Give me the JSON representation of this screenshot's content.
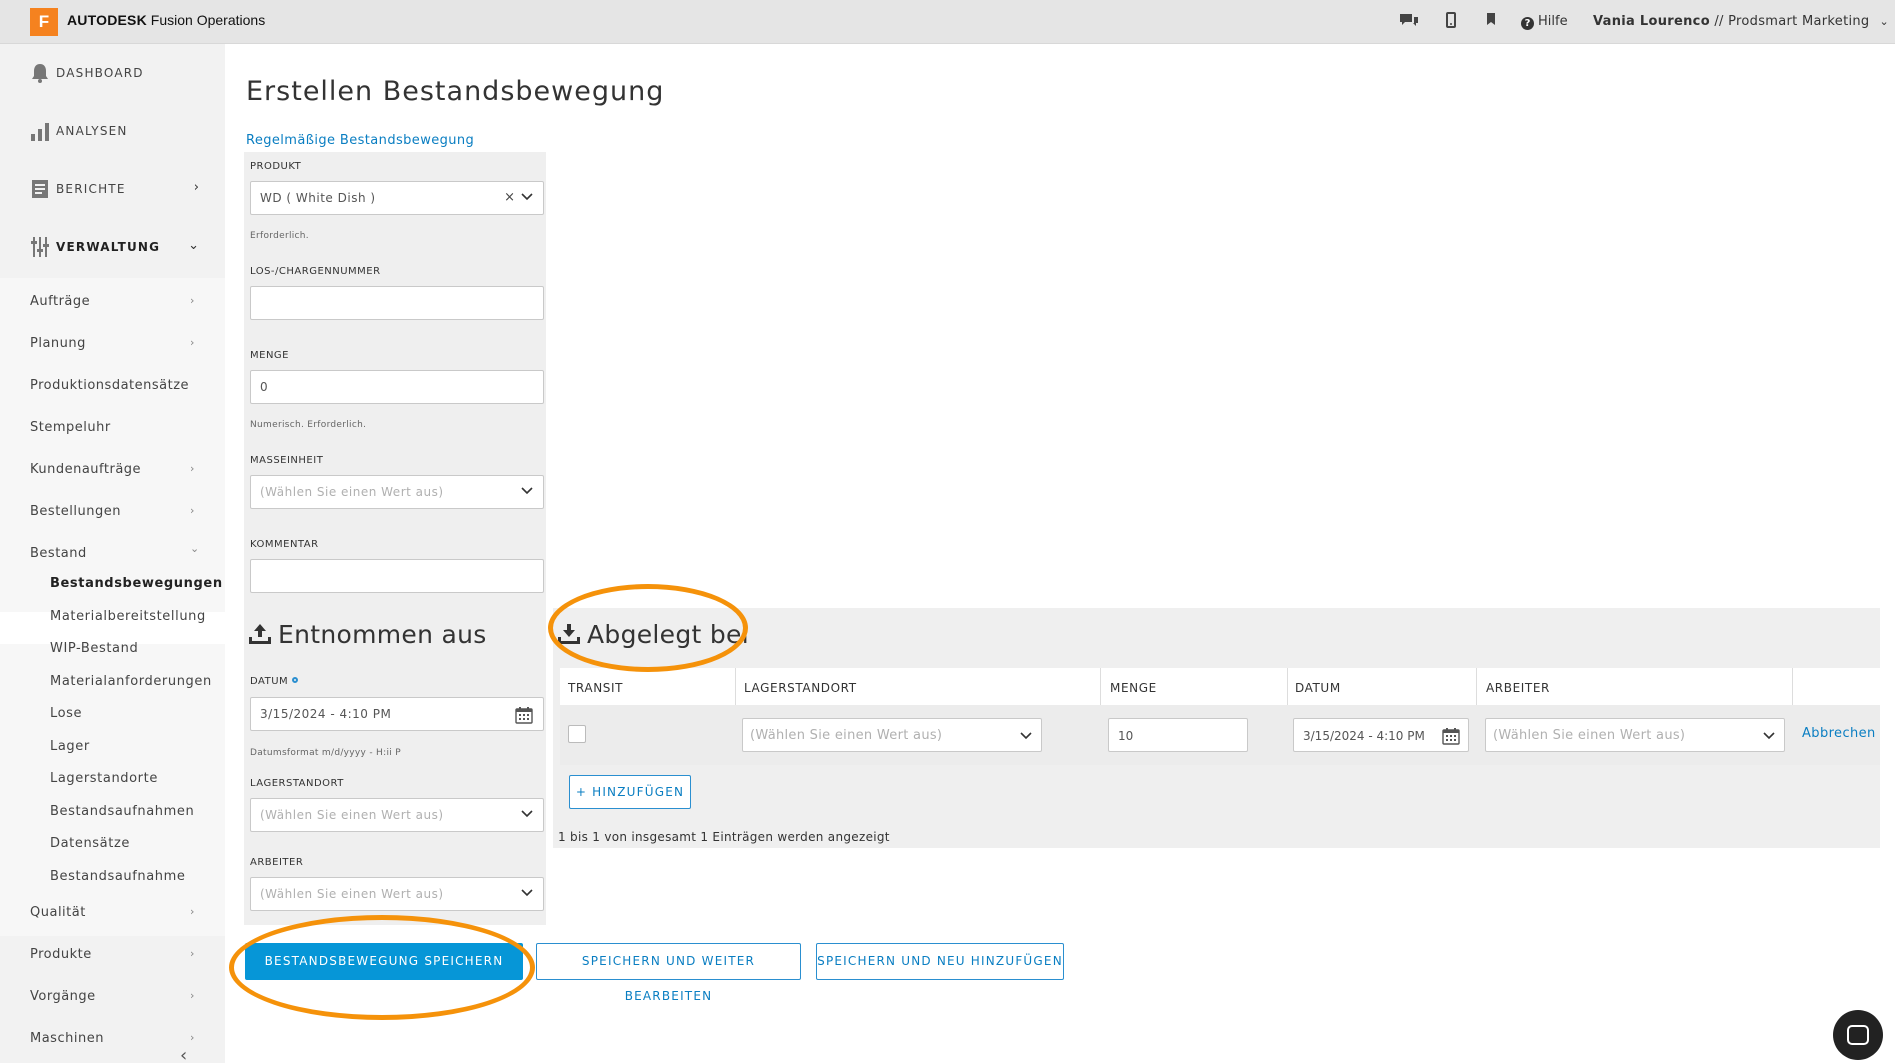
{
  "header": {
    "logo_letter": "F",
    "brand_bold": "AUTODESK",
    "brand_rest": "Fusion Operations",
    "help_label": "Hilfe",
    "user_name": "Vania Lourenco",
    "user_org": " // Prodsmart Marketing"
  },
  "sidebar": {
    "main": [
      {
        "label": "DASHBOARD",
        "icon": "bell-icon"
      },
      {
        "label": "ANALYSEN",
        "icon": "bar-chart-icon"
      },
      {
        "label": "BERICHTE",
        "icon": "document-icon"
      },
      {
        "label": "VERWALTUNG",
        "icon": "sliders-icon"
      }
    ],
    "sub": [
      {
        "label": "Aufträge",
        "has_arrow": true
      },
      {
        "label": "Planung",
        "has_arrow": true
      },
      {
        "label": "Produktionsdatensätze",
        "has_arrow": false
      },
      {
        "label": "Stempeluhr",
        "has_arrow": false
      },
      {
        "label": "Kundenaufträge",
        "has_arrow": true
      },
      {
        "label": "Bestellungen",
        "has_arrow": true
      },
      {
        "label": "Bestand",
        "has_arrow": true
      }
    ],
    "bestand_items": [
      "Bestandsbewegungen",
      "Materialbereitstellung",
      "WIP-Bestand",
      "Materialanforderungen",
      "Lose",
      "Lager",
      "Lagerstandorte",
      "Bestandsaufnahmen",
      "Datensätze",
      "Bestandsaufnahme"
    ],
    "lower": [
      {
        "label": "Qualität"
      },
      {
        "label": "Produkte"
      },
      {
        "label": "Vorgänge"
      },
      {
        "label": "Maschinen"
      }
    ]
  },
  "page": {
    "title": "Erstellen Bestandsbewegung",
    "regular_link": "Regelmäßige Bestandsbewegung"
  },
  "form": {
    "product_label": "PRODUKT",
    "product_value": "WD ( White Dish )",
    "product_hint": "Erforderlich.",
    "lot_label": "LOS-/CHARGENNUMMER",
    "lot_value": "",
    "qty_label": "MENGE",
    "qty_value": "0",
    "qty_hint": "Numerisch. Erforderlich.",
    "unit_label": "MASSEINHEIT",
    "unit_placeholder": "(Wählen Sie einen Wert aus)",
    "comment_label": "KOMMENTAR",
    "comment_value": ""
  },
  "source": {
    "title": "Entnommen aus",
    "date_label": "DATUM",
    "date_value": "3/15/2024 - 4:10 PM",
    "date_hint": "Datumsformat m/d/yyyy - H:ii P",
    "location_label": "LAGERSTANDORT",
    "location_placeholder": "(Wählen Sie einen Wert aus)",
    "worker_label": "ARBEITER",
    "worker_placeholder": "(Wählen Sie einen Wert aus)"
  },
  "destination": {
    "title": "Abgelegt bei",
    "columns": [
      "TRANSIT",
      "LAGERSTANDORT",
      "MENGE",
      "DATUM",
      "ARBEITER"
    ],
    "row": {
      "transit_checked": false,
      "location_placeholder": "(Wählen Sie einen Wert aus)",
      "qty_value": "10",
      "date_value": "3/15/2024 - 4:10 PM",
      "worker_placeholder": "(Wählen Sie einen Wert aus)",
      "cancel_label": "Abbrechen"
    },
    "add_label": "HINZUFÜGEN",
    "count_text": "1 bis 1 von insgesamt 1 Einträgen werden angezeigt"
  },
  "actions": {
    "save": "BESTANDSBEWEGUNG SPEICHERN",
    "save_continue": "SPEICHERN UND WEITER BEARBEITEN",
    "save_new": "SPEICHERN UND NEU HINZUFÜGEN"
  },
  "colors": {
    "accent": "#0696d7",
    "link": "#0a7ec2",
    "annotation": "#f5920a",
    "logo": "#f5821f"
  }
}
